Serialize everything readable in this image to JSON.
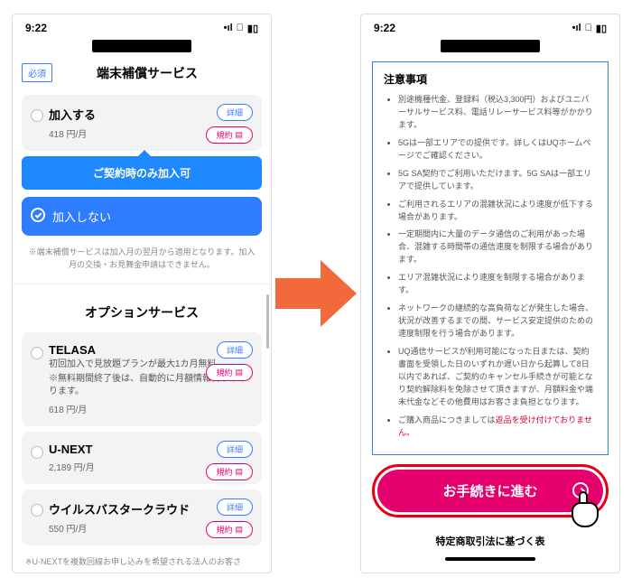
{
  "status": {
    "time": "9:22",
    "signal": "􀙇",
    "wifi": "􀙈",
    "battery": "􀛨"
  },
  "left": {
    "required_badge": "必須",
    "section1_title": "端末補償サービス",
    "join": {
      "label": "加入する",
      "price": "418 円/月"
    },
    "pills": {
      "detail": "詳細",
      "terms": "規約"
    },
    "tooltip": "ご契約時のみ加入可",
    "nojoin": "加入しない",
    "note": "※端末補償サービスは加入月の翌月から適用となります。加入月の交換・お見舞金申請はできません。",
    "section2_title": "オプションサービス",
    "opts": [
      {
        "name": "TELASA",
        "sub": "初回加入で見放題プランが最大1カ月無料",
        "sub2": "※無料期間終了後は、自動的に月額情報料がかかります。",
        "price": "618 円/月"
      },
      {
        "name": "U-NEXT",
        "price": "2,189 円/月"
      },
      {
        "name": "ウイルスバスタークラウド",
        "price": "550 円/月"
      }
    ],
    "footer_note": "※U-NEXTを複数回線お申し込みを希望される法人のお客さ"
  },
  "right": {
    "notice_title": "注意事項",
    "bullets": [
      "別途機種代金、登録料（税込3,300円）およびユニバーサルサービス料、電話リレーサービス料等がかかります。",
      "5Gは一部エリアでの提供です。詳しくはUQホームページでご確認ください。",
      "5G SA契約でご利用いただけます。5G SAは一部エリアで提供しています。",
      "ご利用されるエリアの混雑状況により速度が低下する場合があります。",
      "一定期間内に大量のデータ通信のご利用があった場合、混雑する時間帯の通信速度を制限する場合があります。",
      "エリア混雑状況により速度を制限する場合があります。",
      "ネットワークの継続的な高負荷などが発生した場合、状況が改善するまでの間、サービス安定提供のための速度制限を行う場合があります。",
      "UQ通信サービスが利用可能になった日または、契約書面を受領した日のいずれか遅い日から起算して8日以内であれば、ご契約のキャンセル手続きが可能となり契約解除料を免除させて頂きますが、月額料金や端末代金などその他費用はお客さま負担となります。"
    ],
    "bullet_last_pre": "ご購入商品につきましては",
    "bullet_last_red": "返品を受け付けておりません。",
    "cta": "お手続きに進む",
    "legal": "特定商取引法に基づく表"
  }
}
